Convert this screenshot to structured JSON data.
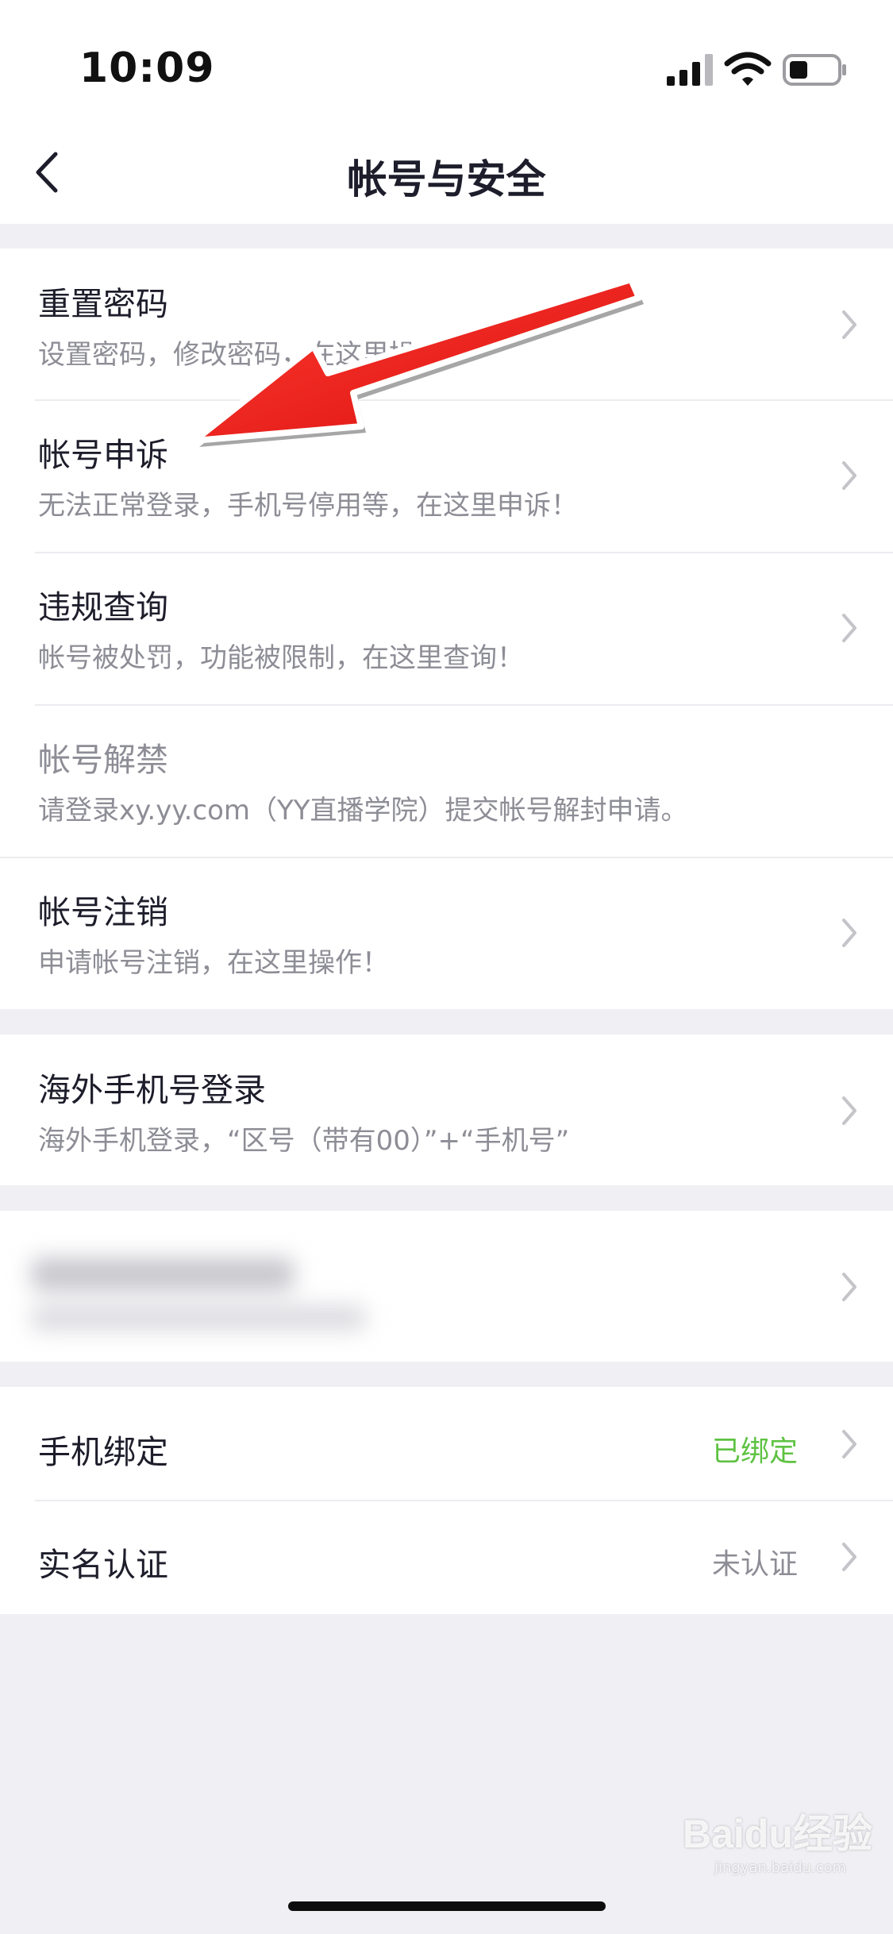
{
  "status_bar": {
    "time": "10:09"
  },
  "nav": {
    "title": "帐号与安全"
  },
  "group1": [
    {
      "title": "重置密码",
      "subtitle": "设置密码，修改密码，在这里操作！"
    },
    {
      "title": "帐号申诉",
      "subtitle": "无法正常登录，手机号停用等，在这里申诉！"
    },
    {
      "title": "违规查询",
      "subtitle": "帐号被处罚，功能被限制，在这里查询！"
    },
    {
      "title": "帐号解禁",
      "subtitle": "请登录xy.yy.com（YY直播学院）提交帐号解封申请。"
    },
    {
      "title": "帐号注销",
      "subtitle": "申请帐号注销，在这里操作！"
    }
  ],
  "group2": {
    "title": "海外手机号登录",
    "subtitle": "海外手机登录，“区号（带有00）”+“手机号”"
  },
  "group4": [
    {
      "title": "手机绑定",
      "value": "已绑定",
      "value_color": "#5ec242"
    },
    {
      "title": "实名认证",
      "value": "未认证",
      "value_color": "#8d8d96"
    }
  ],
  "watermark": {
    "text": "Baidu经验",
    "sub": "jingyan.baidu.com"
  }
}
